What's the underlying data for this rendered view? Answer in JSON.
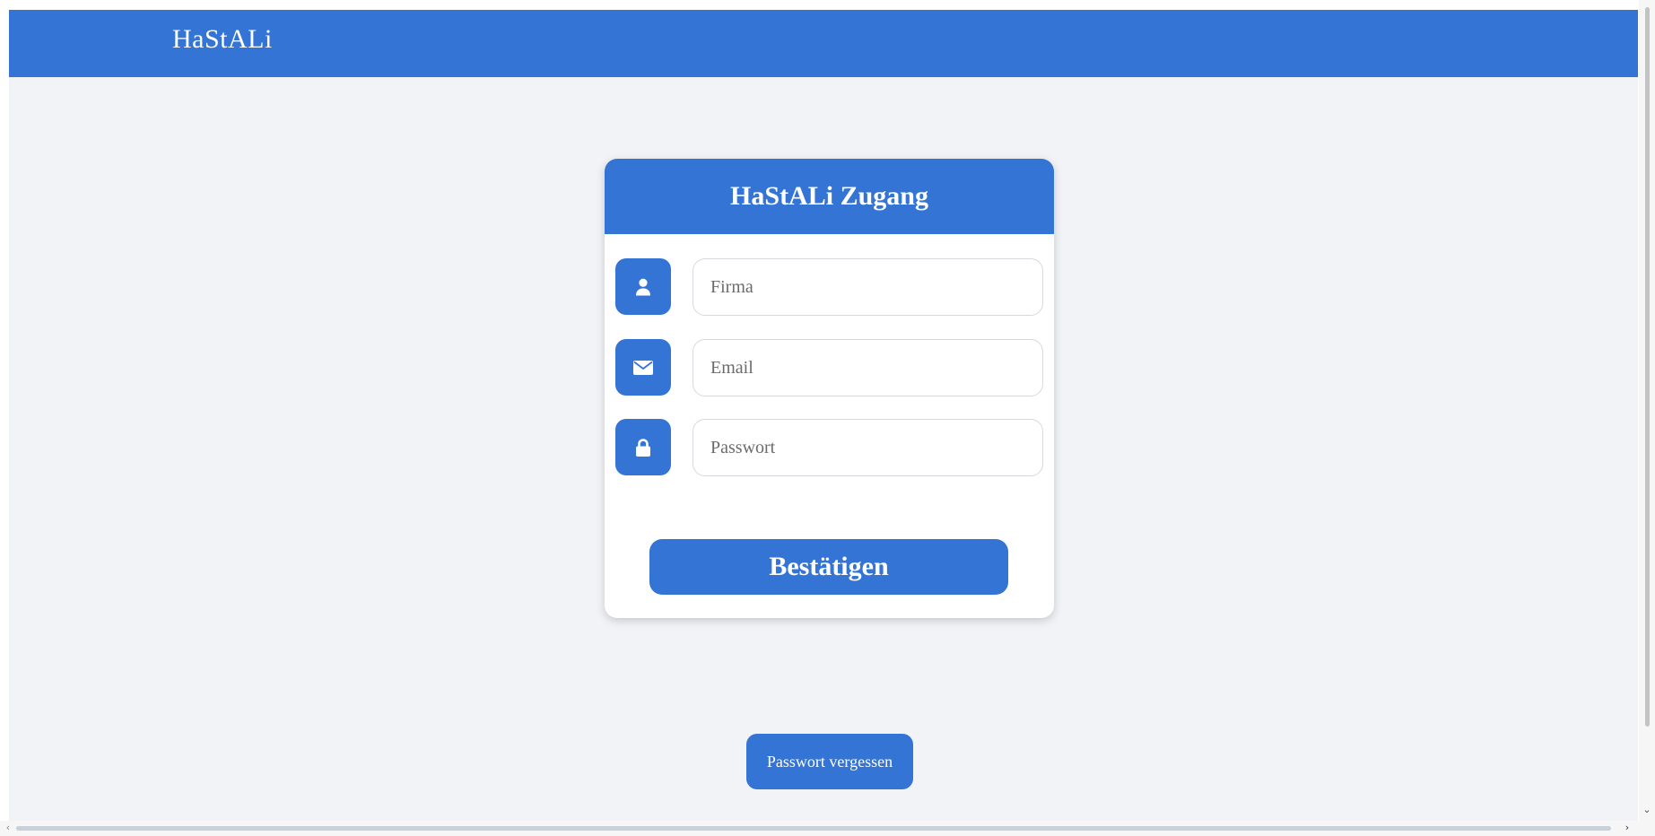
{
  "navbar": {
    "brand": "HaStALi",
    "background": "#3474d4"
  },
  "login_card": {
    "title": "HaStALi Zugang",
    "fields": [
      {
        "name": "firma",
        "placeholder": "Firma",
        "value": "",
        "icon": "user-icon"
      },
      {
        "name": "email",
        "placeholder": "Email",
        "value": "",
        "icon": "envelope-icon"
      },
      {
        "name": "passwort",
        "placeholder": "Passwort",
        "value": "",
        "icon": "lock-icon"
      }
    ],
    "submit_label": "Bestätigen"
  },
  "forgot_password_label": "Passwort vergessen",
  "colors": {
    "accent": "#3474d4",
    "page_background": "#f1f3f7",
    "card_background": "#ffffff"
  }
}
